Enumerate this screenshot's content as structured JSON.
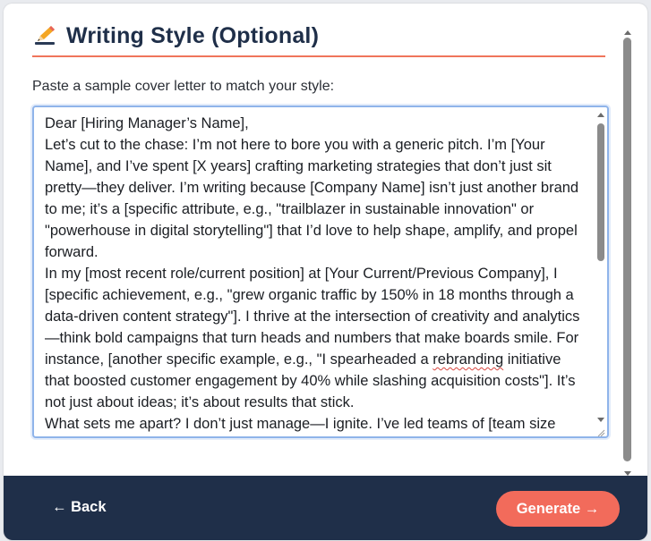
{
  "header": {
    "icon": "pencil-icon",
    "title": "Writing Style (Optional)"
  },
  "form": {
    "label": "Paste a sample cover letter to match your style:",
    "sample_lines": [
      "Dear [Hiring Manager’s Name],",
      "Let’s cut to the chase: I’m not here to bore you with a generic pitch. I’m [Your Name], and I’ve spent [X years] crafting marketing strategies that don’t just sit pretty—they deliver. I’m writing because [Company Name] isn’t just another brand to me; it’s a [specific attribute, e.g., \"trailblazer in sustainable innovation\" or \"powerhouse in digital storytelling\"] that I’d love to help shape, amplify, and propel forward.",
      "In my [most recent role/current position] at [Your Current/Previous Company], I [specific achievement, e.g., \"grew organic traffic by 150% in 18 months through a data-driven content strategy\"]. I thrive at the intersection of creativity and analytics—think bold campaigns that turn heads and numbers that make boards smile. For instance, [another specific example, e.g., \"I spearheaded a ",
      "rebranding",
      " initiative that boosted customer engagement by 40% while slashing acquisition costs\"]. It’s not just about ideas; it’s about results that stick.",
      "What sets me apart? I don’t just manage—I ignite. I’ve led teams of [team size"
    ]
  },
  "footer": {
    "back_label": "← Back",
    "generate_label": "Generate →"
  },
  "colors": {
    "accent": "#f26b5b",
    "footer_bg": "#1f2f49",
    "title": "#1f2f49",
    "textarea_focus": "#8fb4ea"
  }
}
